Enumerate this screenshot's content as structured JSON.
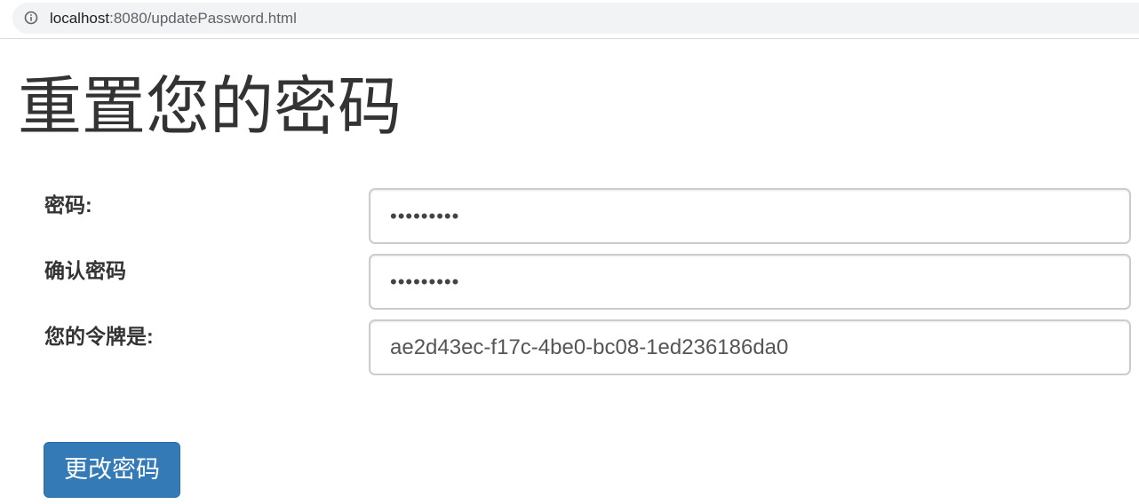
{
  "browser": {
    "url_host": "localhost",
    "url_rest": ":8080/updatePassword.html",
    "info_icon": "info-icon"
  },
  "page": {
    "title": "重置您的密码"
  },
  "form": {
    "password_label": "密码:",
    "password_value": "123456789",
    "confirm_label": "确认密码",
    "confirm_value": "123456789",
    "token_label": "您的令牌是:",
    "token_value": "ae2d43ec-f17c-4be0-bc08-1ed236186da0",
    "submit_label": "更改密码"
  },
  "colors": {
    "button_bg": "#337ab7",
    "text": "#333333",
    "input_border": "#cccccc"
  }
}
